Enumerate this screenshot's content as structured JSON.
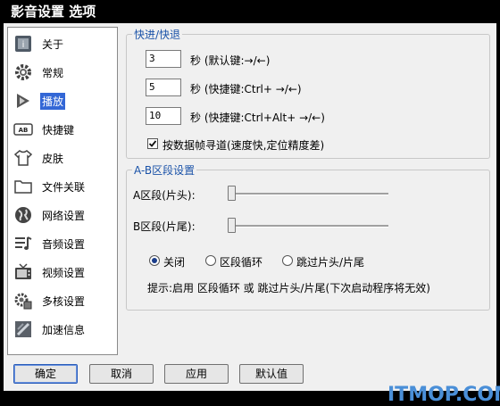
{
  "window": {
    "title": "影音设置 选项"
  },
  "sidebar": {
    "items": [
      {
        "label": "关于",
        "icon": "about-icon"
      },
      {
        "label": "常规",
        "icon": "gear-icon"
      },
      {
        "label": "播放",
        "icon": "play-icon",
        "selected": true
      },
      {
        "label": "快捷键",
        "icon": "hotkey-icon"
      },
      {
        "label": "皮肤",
        "icon": "shirt-icon"
      },
      {
        "label": "文件关联",
        "icon": "folder-icon"
      },
      {
        "label": "网络设置",
        "icon": "globe-icon"
      },
      {
        "label": "音频设置",
        "icon": "audio-icon"
      },
      {
        "label": "视频设置",
        "icon": "tv-icon"
      },
      {
        "label": "多核设置",
        "icon": "cpu-gear-icon"
      },
      {
        "label": "加速信息",
        "icon": "accel-icon"
      }
    ]
  },
  "seek": {
    "legend": "快进/快退",
    "rows": [
      {
        "value": "3",
        "label": "秒 (默认键:→/←)"
      },
      {
        "value": "5",
        "label": "秒 (快捷键:Ctrl+ →/←)"
      },
      {
        "value": "10",
        "label": "秒 (快捷键:Ctrl+Alt+ →/←)"
      }
    ],
    "keyframe_checkbox": {
      "label": "按数据帧寻道(速度快,定位精度差)",
      "checked": true
    }
  },
  "ab": {
    "legend": "A-B区段设置",
    "a_label": "A区段(片头):",
    "b_label": "B区段(片尾):",
    "a_value": 0,
    "b_value": 0,
    "radios": [
      {
        "label": "关闭",
        "checked": true
      },
      {
        "label": "区段循环",
        "checked": false
      },
      {
        "label": "跳过片头/片尾",
        "checked": false
      }
    ],
    "hint": "提示:启用 区段循环 或 跳过片头/片尾(下次启动程序将无效)"
  },
  "buttons": {
    "ok": "确定",
    "cancel": "取消",
    "apply": "应用",
    "default": "默认值"
  },
  "watermark": "ITMOP.COM"
}
